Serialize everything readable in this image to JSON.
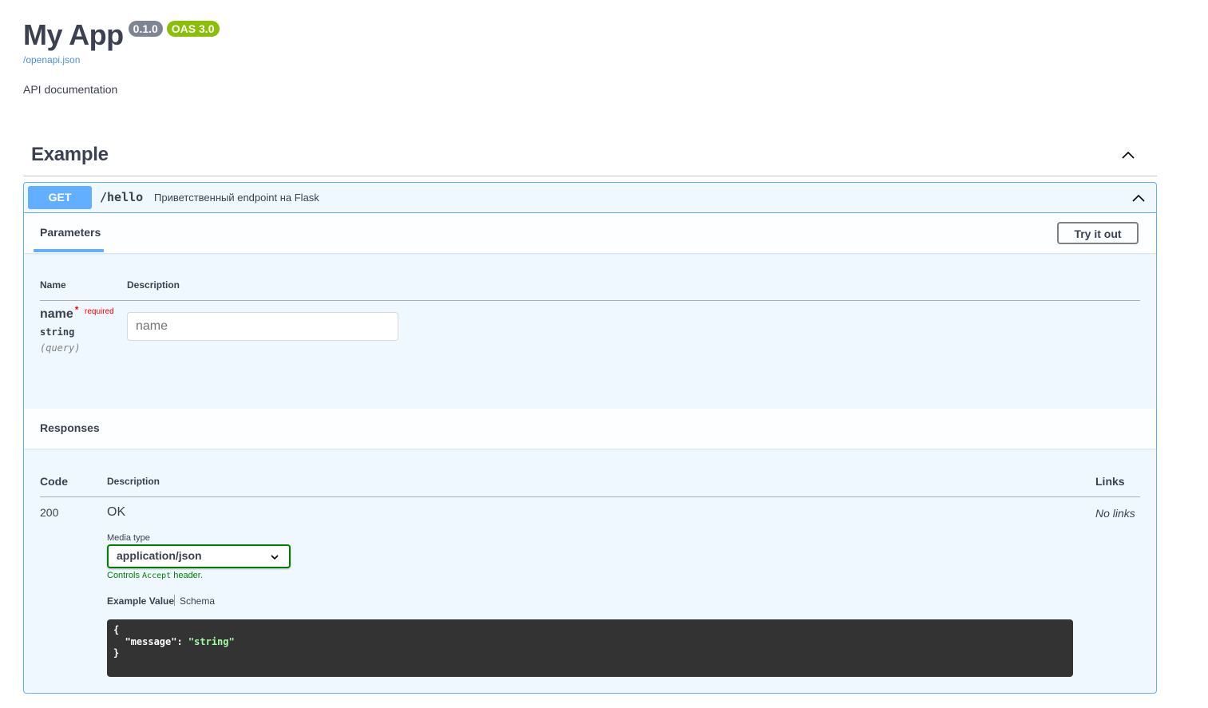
{
  "info": {
    "title": "My App",
    "version": "0.1.0",
    "oas": "OAS 3.0",
    "spec_link": "/openapi.json",
    "description": "API documentation"
  },
  "tag": {
    "name": "Example"
  },
  "operation": {
    "method": "GET",
    "path": "/hello",
    "summary": "Приветственный endpoint на Flask",
    "parameters_tab": "Parameters",
    "try_it_out": "Try it out",
    "param_columns": {
      "name": "Name",
      "description": "Description"
    },
    "parameter": {
      "name": "name",
      "required_star": "*",
      "required_label": "required",
      "type": "string",
      "in": "(query)",
      "placeholder": "name"
    },
    "responses": {
      "title": "Responses",
      "columns": {
        "code": "Code",
        "description": "Description",
        "links": "Links"
      },
      "rows": [
        {
          "code": "200",
          "description": "OK",
          "links": "No links",
          "media_type_label": "Media type",
          "media_type": "application/json",
          "controls_note_before": "Controls ",
          "controls_note_code": "Accept",
          "controls_note_after": " header.",
          "example_tab": "Example Value",
          "schema_tab": "Schema",
          "example_lines": [
            "{",
            "  \"message\": ",
            "\"string\"",
            "}"
          ]
        }
      ]
    }
  },
  "colors": {
    "get_method": "#61affe",
    "oas_badge": "#89bf04",
    "version_badge": "#7d8492",
    "media_select_border": "#008000",
    "code_background": "#333333",
    "code_string": "#a2fca2"
  },
  "icons": {
    "tag_toggle": "chevron-up-icon",
    "op_toggle": "chevron-up-icon",
    "select_arrow": "chevron-down-icon"
  }
}
